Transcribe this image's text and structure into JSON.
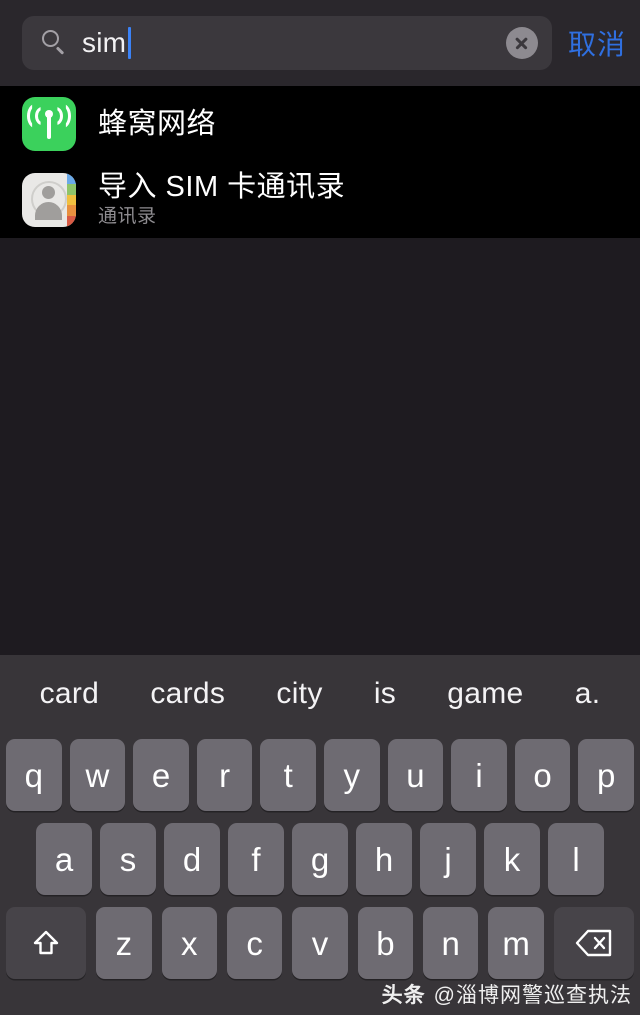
{
  "search": {
    "icon": "search-icon",
    "value": "sim",
    "clear_icon": "clear-circle-icon",
    "cancel_label": "取消",
    "cancel_color": "#2f6fe0",
    "caret_color": "#3b82f6"
  },
  "results": [
    {
      "icon": "cellular-icon",
      "icon_color": "#3bd15c",
      "title": "蜂窝网络",
      "subtitle": ""
    },
    {
      "icon": "contacts-icon",
      "icon_color": "#e9e8e6",
      "title": "导入 SIM 卡通讯录",
      "subtitle": "通讯录"
    }
  ],
  "keyboard": {
    "suggestions": [
      "card",
      "cards",
      "city",
      "is",
      "game",
      "a."
    ],
    "row1": [
      "q",
      "w",
      "e",
      "r",
      "t",
      "y",
      "u",
      "i",
      "o",
      "p"
    ],
    "row2": [
      "a",
      "s",
      "d",
      "f",
      "g",
      "h",
      "j",
      "k",
      "l"
    ],
    "row3": [
      "z",
      "x",
      "c",
      "v",
      "b",
      "n",
      "m"
    ],
    "shift_icon": "shift-icon",
    "backspace_icon": "backspace-icon"
  },
  "watermark": {
    "tag": "头条",
    "handle": "@淄博网警巡查执法"
  }
}
